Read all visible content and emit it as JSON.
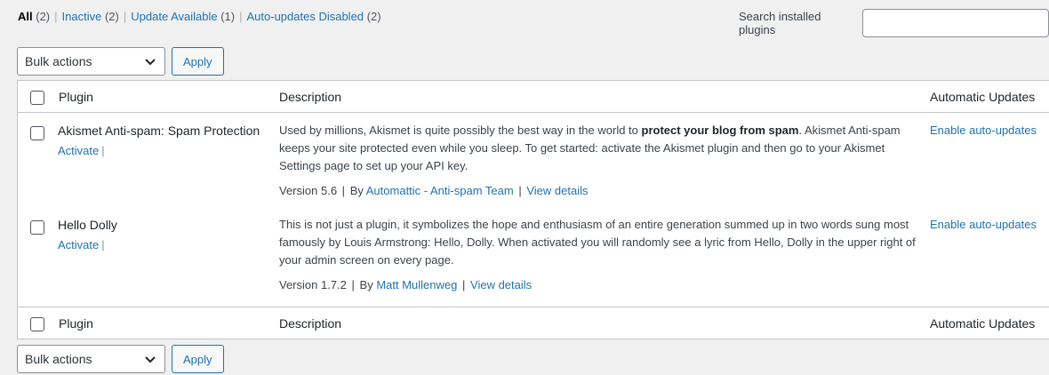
{
  "filters": {
    "all": {
      "label": "All",
      "count": "(2)"
    },
    "inactive": {
      "label": "Inactive",
      "count": "(2)"
    },
    "update": {
      "label": "Update Available",
      "count": "(1)"
    },
    "autodisabled": {
      "label": "Auto-updates Disabled",
      "count": "(2)"
    },
    "separator": "|"
  },
  "search": {
    "label": "Search installed plugins",
    "value": "",
    "placeholder": ""
  },
  "bulk": {
    "selected": "Bulk actions",
    "apply_label": "Apply"
  },
  "table": {
    "columns": {
      "plugin": "Plugin",
      "description": "Description",
      "auto_updates": "Automatic Updates"
    },
    "rows": [
      {
        "name": "Akismet Anti-spam: Spam Protection",
        "action": "Activate",
        "pipe": "|",
        "desc_pre": "Used by millions, Akismet is quite possibly the best way in the world to ",
        "desc_bold": "protect your blog from spam",
        "desc_post": ". Akismet Anti-spam keeps your site protected even while you sleep. To get started: activate the Akismet plugin and then go to your Akismet Settings page to set up your API key.",
        "version": "Version 5.6",
        "by": "By",
        "author": "Automattic - Anti-spam Team",
        "details": "View details",
        "auto": "Enable auto-updates"
      },
      {
        "name": "Hello Dolly",
        "action": "Activate",
        "pipe": "|",
        "desc": "This is not just a plugin, it symbolizes the hope and enthusiasm of an entire generation summed up in two words sung most famously by Louis Armstrong: Hello, Dolly. When activated you will randomly see a lyric from Hello, Dolly in the upper right of your admin screen on every page.",
        "version": "Version 1.7.2",
        "by": "By",
        "author": "Matt Mullenweg",
        "details": "View details",
        "auto": "Enable auto-updates"
      }
    ]
  }
}
